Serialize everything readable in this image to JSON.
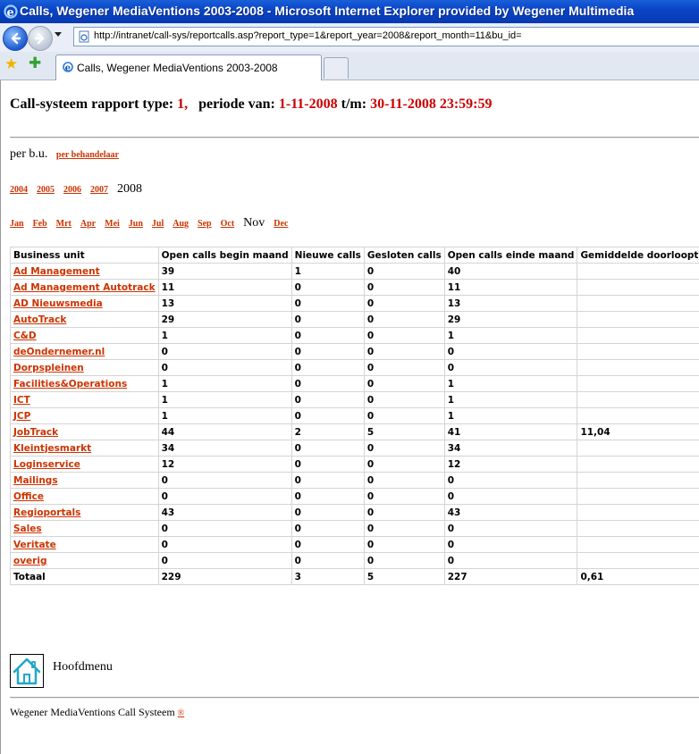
{
  "window": {
    "title": "Calls, Wegener MediaVentions 2003-2008 - Microsoft Internet Explorer provided by Wegener Multimedia"
  },
  "address": {
    "url": "http://intranet/call-sys/reportcalls.asp?report_type=1&report_year=2008&report_month=11&bu_id="
  },
  "tab": {
    "label": "Calls, Wegener MediaVentions 2003-2008"
  },
  "heading": {
    "prefix": "Call-systeem rapport type:",
    "type": "1,",
    "periode_label": "periode van:",
    "from": "1-11-2008",
    "tm_label": "t/m:",
    "to": "30-11-2008 23:59:59"
  },
  "view": {
    "current": "per b.u.",
    "alt_link": "per behandelaar"
  },
  "years": {
    "links": [
      "2004",
      "2005",
      "2006",
      "2007"
    ],
    "current": "2008"
  },
  "months": {
    "before": [
      "Jan",
      "Feb",
      "Mrt",
      "Apr",
      "Mei",
      "Jun",
      "Jul",
      "Aug",
      "Sep",
      "Oct"
    ],
    "current": "Nov",
    "after": [
      "Dec"
    ]
  },
  "table": {
    "headers": [
      "Business unit",
      "Open calls begin maand",
      "Nieuwe calls",
      "Gesloten calls",
      "Open calls einde maand",
      "Gemiddelde doorlooptijd"
    ],
    "rows": [
      {
        "unit": "Ad Management",
        "open_begin": "39",
        "new": "1",
        "closed": "0",
        "open_end": "40",
        "avg": ""
      },
      {
        "unit": "Ad Management Autotrack",
        "open_begin": "11",
        "new": "0",
        "closed": "0",
        "open_end": "11",
        "avg": ""
      },
      {
        "unit": "AD Nieuwsmedia",
        "open_begin": "13",
        "new": "0",
        "closed": "0",
        "open_end": "13",
        "avg": ""
      },
      {
        "unit": "AutoTrack",
        "open_begin": "29",
        "new": "0",
        "closed": "0",
        "open_end": "29",
        "avg": ""
      },
      {
        "unit": "C&D",
        "open_begin": "1",
        "new": "0",
        "closed": "0",
        "open_end": "1",
        "avg": ""
      },
      {
        "unit": "deOndernemer.nl",
        "open_begin": "0",
        "new": "0",
        "closed": "0",
        "open_end": "0",
        "avg": ""
      },
      {
        "unit": "Dorpspleinen",
        "open_begin": "0",
        "new": "0",
        "closed": "0",
        "open_end": "0",
        "avg": ""
      },
      {
        "unit": "Facilities&Operations",
        "open_begin": "1",
        "new": "0",
        "closed": "0",
        "open_end": "1",
        "avg": ""
      },
      {
        "unit": "ICT",
        "open_begin": "1",
        "new": "0",
        "closed": "0",
        "open_end": "1",
        "avg": ""
      },
      {
        "unit": "JCP",
        "open_begin": "1",
        "new": "0",
        "closed": "0",
        "open_end": "1",
        "avg": ""
      },
      {
        "unit": "JobTrack",
        "open_begin": "44",
        "new": "2",
        "closed": "5",
        "open_end": "41",
        "avg": "11,04"
      },
      {
        "unit": "Kleintjesmarkt",
        "open_begin": "34",
        "new": "0",
        "closed": "0",
        "open_end": "34",
        "avg": ""
      },
      {
        "unit": "Loginservice",
        "open_begin": "12",
        "new": "0",
        "closed": "0",
        "open_end": "12",
        "avg": ""
      },
      {
        "unit": "Mailings",
        "open_begin": "0",
        "new": "0",
        "closed": "0",
        "open_end": "0",
        "avg": ""
      },
      {
        "unit": "Office",
        "open_begin": "0",
        "new": "0",
        "closed": "0",
        "open_end": "0",
        "avg": ""
      },
      {
        "unit": "Regioportals",
        "open_begin": "43",
        "new": "0",
        "closed": "0",
        "open_end": "43",
        "avg": ""
      },
      {
        "unit": "Sales",
        "open_begin": "0",
        "new": "0",
        "closed": "0",
        "open_end": "0",
        "avg": ""
      },
      {
        "unit": "Veritate",
        "open_begin": "0",
        "new": "0",
        "closed": "0",
        "open_end": "0",
        "avg": ""
      },
      {
        "unit": "overig",
        "open_begin": "0",
        "new": "0",
        "closed": "0",
        "open_end": "0",
        "avg": ""
      }
    ],
    "total": {
      "unit": "Totaal",
      "open_begin": "229",
      "new": "3",
      "closed": "5",
      "open_end": "227",
      "avg": "0,61"
    }
  },
  "home": {
    "label": "Hoofdmenu",
    "icon": "home-icon"
  },
  "footer": {
    "text": "Wegener MediaVentions Call Systeem",
    "copyright": "®"
  },
  "colors": {
    "link": "#cc3300",
    "highlight_red": "#cc0000",
    "titlebar": "#0a45c8",
    "home_icon": "#20a8c8"
  }
}
